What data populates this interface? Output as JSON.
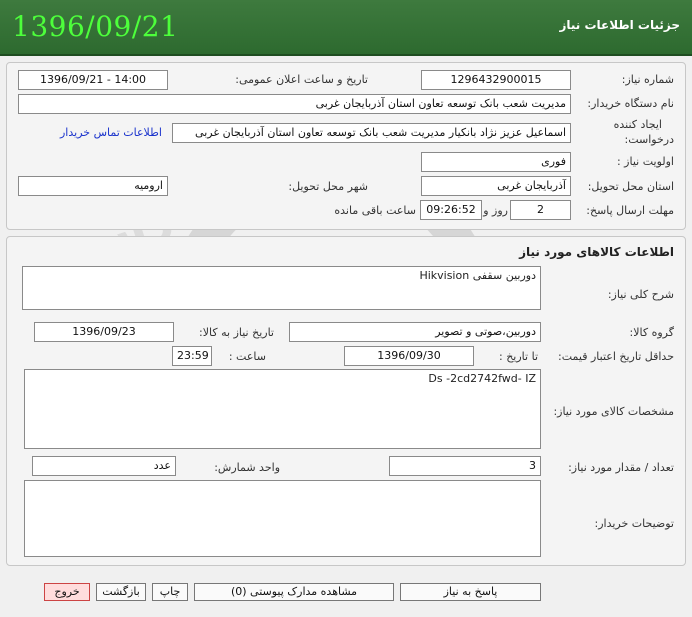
{
  "header": {
    "title": "جزئیات اطلاعات نیاز",
    "date": "1396/09/21"
  },
  "form": {
    "need_number_label": "شماره نیاز:",
    "need_number": "1296432900015",
    "announce_label": "تاریخ و ساعت اعلان عمومی:",
    "announce_value": "1396/09/21 - 14:00",
    "buyer_org_label": "نام دستگاه خریدار:",
    "buyer_org": "مدیریت شعب بانک توسعه تعاون استان آذربایجان غربی",
    "creator_label_1": "ایجاد کننده",
    "creator_label_2": "درخواست:",
    "creator": "اسماعیل عزیز نژاد بانکیار مدیریت شعب بانک توسعه تعاون استان آذربایجان غربی",
    "contact_link": "اطلاعات تماس خریدار",
    "priority_label": "اولویت نیاز :",
    "priority": "فوری",
    "province_label": "استان محل تحویل:",
    "province": "آذربایجان غربی",
    "city_label": "شهر محل تحویل:",
    "city": "ارومیه",
    "deadline_label": "مهلت ارسال پاسخ:",
    "deadline_days": "2",
    "days_word": "روز و",
    "deadline_time": "09:26:52",
    "remaining_word": "ساعت باقی مانده"
  },
  "goods": {
    "section_title": "اطلاعات کالاهای مورد نیاز",
    "general_desc_label": "شرح کلی نیاز:",
    "general_desc": "دوربین سقفی Hikvision",
    "group_label": "گروه کالا:",
    "group": "دوربین،صوتی و تصویر",
    "need_date_label": "تاریخ نیاز به کالا:",
    "need_date": "1396/09/23",
    "min_validity_label": "حداقل تاریخ اعتبار قیمت:",
    "until_date_label": "تا تاریخ :",
    "until_date": "1396/09/30",
    "time_label": "ساعت :",
    "time": "23:59",
    "specs_label": "مشخصات کالای مورد نیاز:",
    "specs": "Ds -2cd2742fwd- IZ",
    "quantity_label": "تعداد / مقدار مورد نیاز:",
    "quantity": "3",
    "unit_label": "واحد شمارش:",
    "unit": "عدد",
    "buyer_notes_label": "توضیحات خریدار:",
    "buyer_notes": ""
  },
  "buttons": {
    "reply": "پاسخ به نیاز",
    "attachments": "مشاهده مدارک پیوستی (0)",
    "print": "چاپ",
    "back": "بازگشت",
    "exit": "خروج"
  },
  "colors": {
    "header_bg": "#2d6a2f",
    "date_green": "#4dff3b",
    "link_blue": "#1a33cc",
    "exit_bg": "#ffdddd"
  }
}
